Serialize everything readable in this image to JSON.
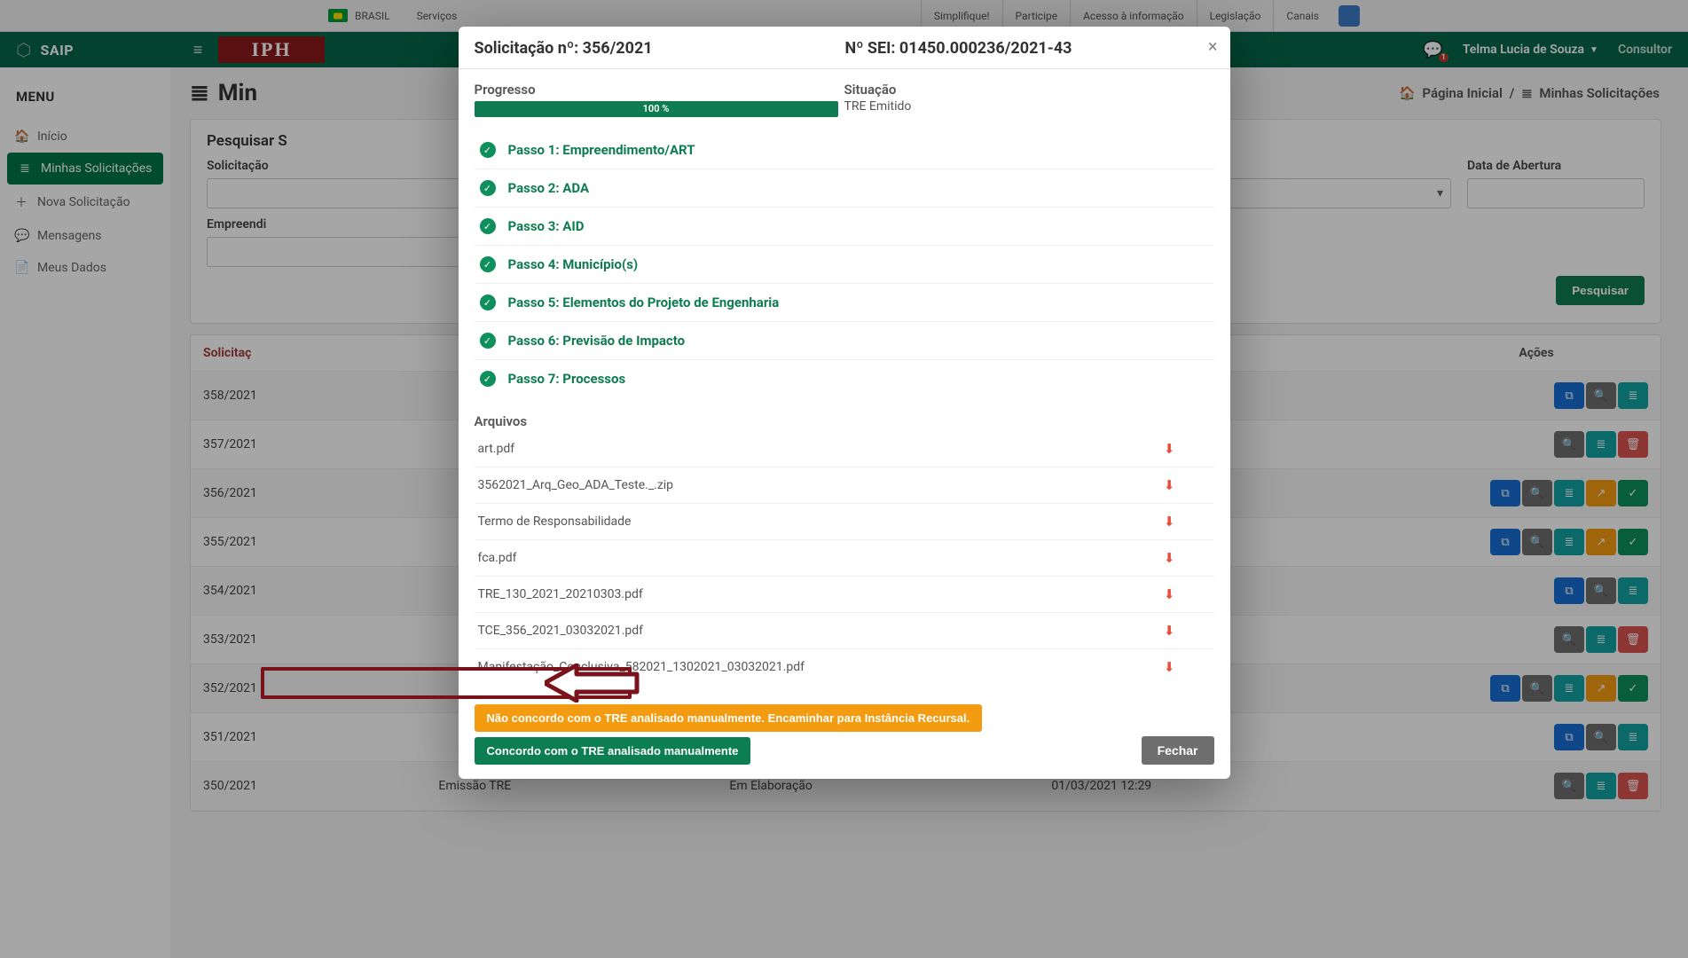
{
  "gov_bar": {
    "country": "BRASIL",
    "services": "Serviços",
    "links": [
      "Simplifique!",
      "Participe",
      "Acesso à informação",
      "Legislação",
      "Canais"
    ]
  },
  "app_header": {
    "brand": "SAIP",
    "logo": "IPH",
    "user_name": "Telma Lucia de Souza",
    "role": "Consultor",
    "message_count": "1"
  },
  "sidebar": {
    "title": "MENU",
    "items": [
      {
        "label": "Início"
      },
      {
        "label": "Minhas Solicitações"
      },
      {
        "label": "Nova Solicitação"
      },
      {
        "label": "Mensagens"
      },
      {
        "label": "Meus Dados"
      }
    ]
  },
  "page": {
    "title_prefix": "Min",
    "breadcrumb_home": "Página Inicial",
    "breadcrumb_sep": "/",
    "breadcrumb_current": "Minhas Solicitações"
  },
  "search": {
    "panel_title_prefix": "Pesquisar S",
    "field_solicitacao": "Solicitação",
    "field_data_abertura": "Data de Abertura",
    "field_empreendi_prefix": "Empreendi",
    "btn_pesquisar": "Pesquisar"
  },
  "table": {
    "headers": {
      "solicitacao": "Solicitaç",
      "acoes": "Ações"
    },
    "rows": [
      {
        "sol": "358/2021",
        "c2": "",
        "c3": "",
        "c4": "",
        "actions": [
          "copy",
          "search",
          "list"
        ]
      },
      {
        "sol": "357/2021",
        "c2": "",
        "c3": "",
        "c4": "",
        "actions": [
          "search",
          "list",
          "delete"
        ]
      },
      {
        "sol": "356/2021",
        "c2": "",
        "c3": "",
        "c4": "",
        "actions": [
          "copy",
          "search",
          "list",
          "share",
          "check"
        ]
      },
      {
        "sol": "355/2021",
        "c2": "",
        "c3": "",
        "c4": "",
        "actions": [
          "copy",
          "search",
          "list",
          "share",
          "check"
        ]
      },
      {
        "sol": "354/2021",
        "c2": "",
        "c3": "",
        "c4": "",
        "actions": [
          "copy",
          "search",
          "list"
        ]
      },
      {
        "sol": "353/2021",
        "c2": "",
        "c3": "",
        "c4": "",
        "actions": [
          "search",
          "list",
          "delete"
        ]
      },
      {
        "sol": "352/2021",
        "c2": "",
        "c3": "",
        "c4": "",
        "actions": [
          "copy",
          "search",
          "list",
          "share",
          "check"
        ]
      },
      {
        "sol": "351/2021",
        "c2": "",
        "c3": "",
        "c4": "",
        "actions": [
          "copy",
          "search",
          "list"
        ]
      },
      {
        "sol": "350/2021",
        "c2": "Emissão TRE",
        "c3": "Em Elaboração",
        "c4": "01/03/2021 12:29",
        "actions": [
          "search",
          "list",
          "delete"
        ]
      }
    ]
  },
  "modal": {
    "title_left": "Solicitação nº: 356/2021",
    "title_right": "Nº SEI: 01450.000236/2021-43",
    "progress_label": "Progresso",
    "progress_pct": "100 %",
    "situacao_label": "Situação",
    "situacao_value": "TRE Emitido",
    "steps": [
      "Passo 1: Empreendimento/ART",
      "Passo 2: ADA",
      "Passo 3: AID",
      "Passo 4: Município(s)",
      "Passo 5: Elementos do Projeto de Engenharia",
      "Passo 6: Previsão de Impacto",
      "Passo 7: Processos"
    ],
    "arquivos_label": "Arquivos",
    "files": [
      "art.pdf",
      "3562021_Arq_Geo_ADA_Teste._.zip",
      "Termo de Responsabilidade",
      "fca.pdf",
      "TRE_130_2021_20210303.pdf",
      "TCE_356_2021_03032021.pdf",
      "Manifestação_Conclusiva_582021_1302021_03032021.pdf"
    ],
    "btn_disagree": "Não concordo com o TRE analisado manualmente. Encaminhar para Instância Recursal.",
    "btn_agree": "Concordo com o TRE analisado manualmente",
    "btn_close": "Fechar"
  },
  "action_glyphs": {
    "copy": "⧉",
    "search": "🔍",
    "list": "≣",
    "delete": "🗑",
    "share": "↗",
    "check": "✓"
  },
  "action_colors": {
    "copy": "ab-blue",
    "search": "ab-gray",
    "list": "ab-teal",
    "delete": "ab-red",
    "share": "ab-orange",
    "check": "ab-green"
  }
}
